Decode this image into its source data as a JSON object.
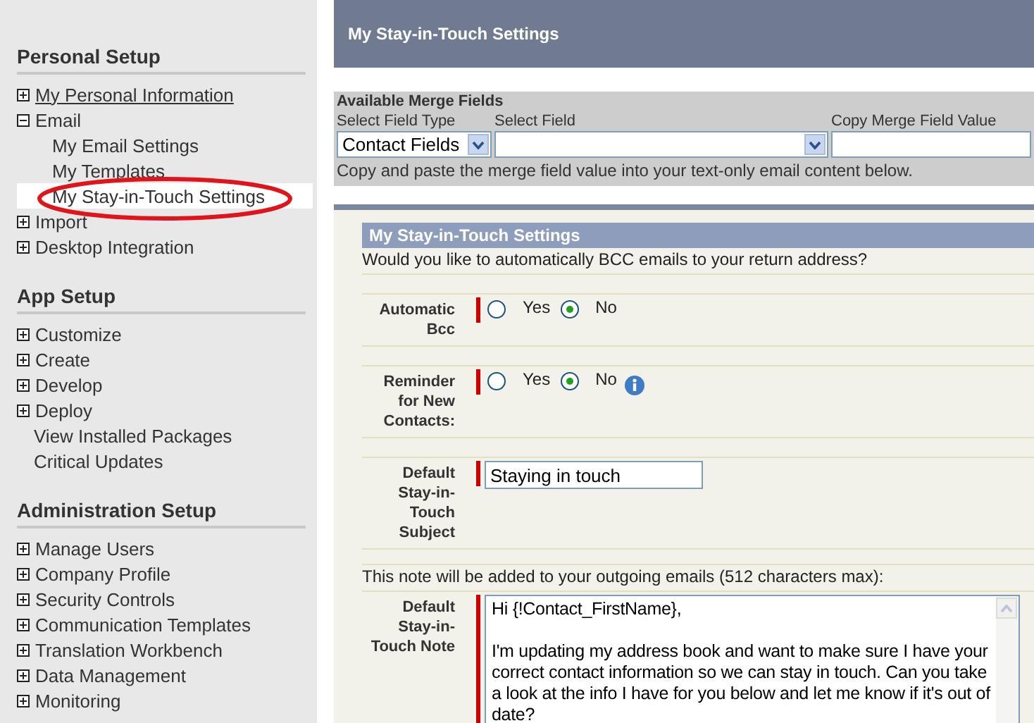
{
  "sidebar": {
    "sections": [
      {
        "title": "Personal Setup",
        "items": [
          {
            "label": "My Personal Information",
            "expanded": false,
            "hovered": true,
            "selected": false
          },
          {
            "label": "Email",
            "expanded": true,
            "hovered": false,
            "selected": false,
            "children": [
              {
                "label": "My Email Settings",
                "hovered": false,
                "selected": false
              },
              {
                "label": "My Templates",
                "hovered": false,
                "selected": false
              },
              {
                "label": "My Stay-in-Touch Settings",
                "hovered": false,
                "selected": true
              }
            ]
          },
          {
            "label": "Import",
            "expanded": false,
            "hovered": false,
            "selected": false
          },
          {
            "label": "Desktop Integration",
            "expanded": false,
            "hovered": false,
            "selected": false
          }
        ]
      },
      {
        "title": "App Setup",
        "items": [
          {
            "label": "Customize",
            "expanded": false,
            "hovered": false,
            "selected": false
          },
          {
            "label": "Create",
            "expanded": false,
            "hovered": false,
            "selected": false
          },
          {
            "label": "Develop",
            "expanded": false,
            "hovered": false,
            "selected": false
          },
          {
            "label": "Deploy",
            "expanded": false,
            "hovered": false,
            "selected": false
          },
          {
            "label": "View Installed Packages",
            "hovered": false,
            "selected": false
          },
          {
            "label": "Critical Updates",
            "hovered": false,
            "selected": false
          }
        ]
      },
      {
        "title": "Administration Setup",
        "items": [
          {
            "label": "Manage Users",
            "expanded": false,
            "hovered": false,
            "selected": false
          },
          {
            "label": "Company Profile",
            "expanded": false,
            "hovered": false,
            "selected": false
          },
          {
            "label": "Security Controls",
            "expanded": false,
            "hovered": false,
            "selected": false
          },
          {
            "label": "Communication Templates",
            "expanded": false,
            "hovered": false,
            "selected": false
          },
          {
            "label": "Translation Workbench",
            "expanded": false,
            "hovered": false,
            "selected": false
          },
          {
            "label": "Data Management",
            "expanded": false,
            "hovered": false,
            "selected": false
          },
          {
            "label": "Monitoring",
            "expanded": false,
            "hovered": false,
            "selected": false
          }
        ]
      }
    ]
  },
  "header": {
    "title": "My Stay-in-Touch Settings"
  },
  "merge_fields": {
    "title": "Available Merge Fields",
    "field_type": {
      "label": "Select Field Type",
      "value": "Contact Fields"
    },
    "field": {
      "label": "Select Field"
    },
    "copy_value": {
      "label": "Copy Merge Field Value"
    },
    "hint": "Copy and paste the merge field value into your text-only email content below."
  },
  "settings": {
    "title": "My Stay-in-Touch Settings",
    "rows": [
      {
        "kind": "text",
        "text": "Would you like to automatically BCC emails to your return address?"
      },
      {
        "kind": "radio",
        "label": "Automatic Bcc",
        "info": false,
        "options": [
          {
            "label": "Yes",
            "selected": false
          },
          {
            "label": "No",
            "selected": true
          }
        ]
      },
      {
        "kind": "radio",
        "label": "Reminder for New Contacts:",
        "info": true,
        "options": [
          {
            "label": "Yes",
            "selected": false
          },
          {
            "label": "No",
            "selected": true
          }
        ]
      },
      {
        "kind": "input",
        "label": "Default Stay-in-Touch Subject",
        "value": "Staying in touch"
      },
      {
        "kind": "text",
        "text": "This note will be added to your outgoing emails (512 characters max):"
      },
      {
        "kind": "textarea",
        "label": "Default Stay-in-Touch Note",
        "value": "Hi {!Contact_FirstName},\n\nI'm updating my address book and want to make sure I have your correct contact information so we can stay in touch. Can you take a look at the info I have for you below and let me know if it's out of date?"
      }
    ]
  }
}
